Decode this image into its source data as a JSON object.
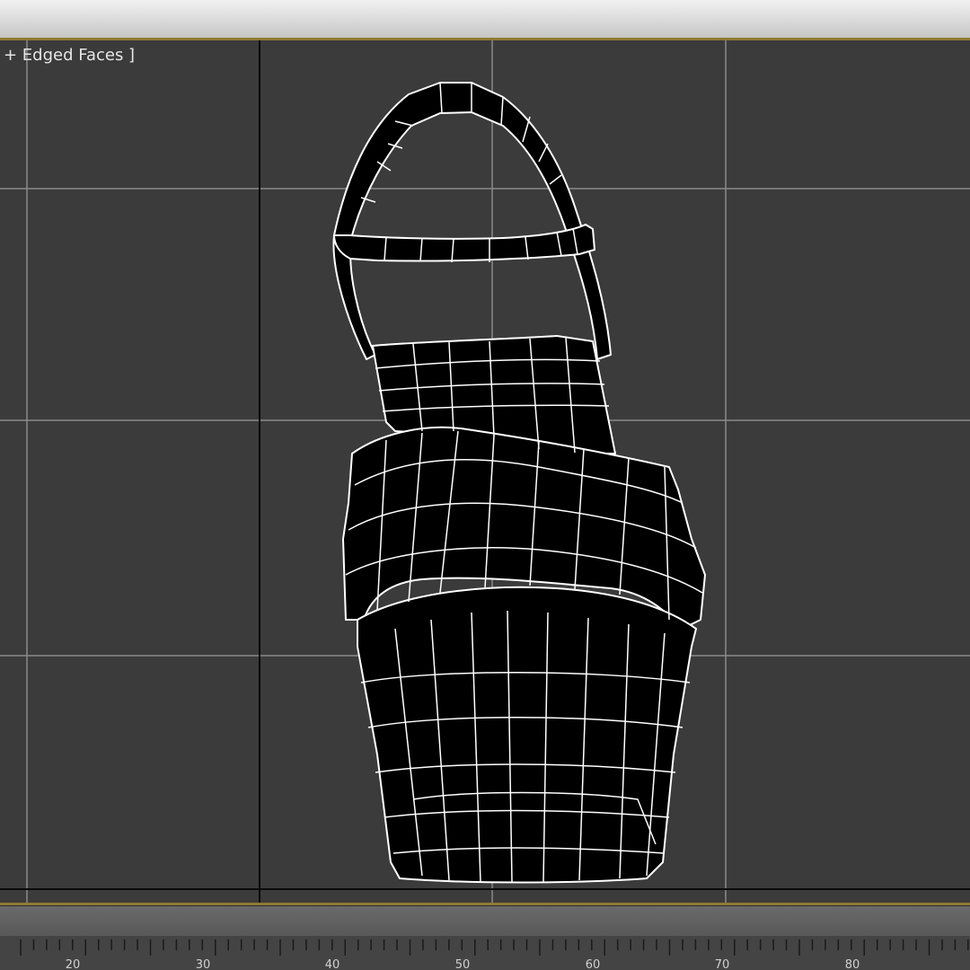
{
  "viewport": {
    "label": "+ Edged Faces ]",
    "background_color": "#3b3b3b",
    "grid_color": "#8a8a8a",
    "axis_color": "#0a0a0a",
    "wire_color": "#ffffff",
    "model": "sandal-wireframe"
  },
  "timeline": {
    "frame_labels": [
      "20",
      "30",
      "40",
      "50",
      "60",
      "70",
      "80"
    ]
  },
  "colors": {
    "frame_accent": "#8f7a33",
    "title_bar": "#dcdcdc"
  }
}
